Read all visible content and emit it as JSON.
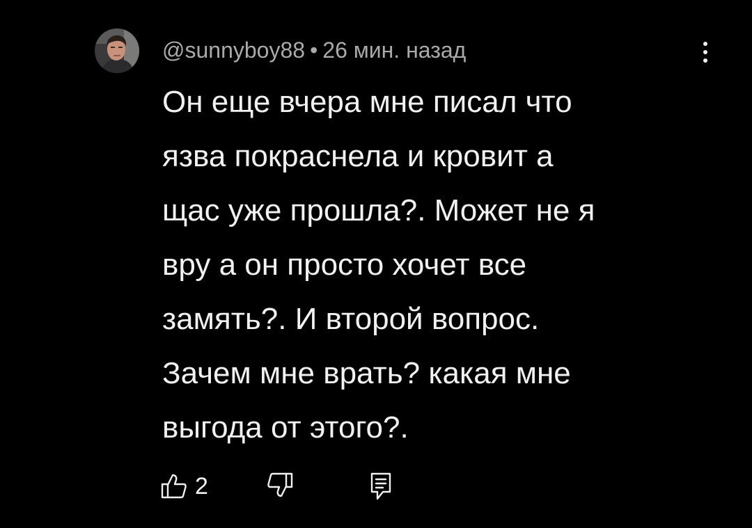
{
  "comment": {
    "author": "@sunnyboy88",
    "separator": "•",
    "time": "26 мин. назад",
    "text": "Он еще вчера мне писал что\nязва покраснела и кровит а\nщас уже прошла?. Может не я\nвру а он просто хочет все\nзамять?. И второй вопрос.\nЗачем мне врать? какая мне\nвыгода от этого?.",
    "likes": "2"
  },
  "icons": {
    "avatar": "user-avatar-photo",
    "menu": "more-vertical-icon",
    "like": "thumbs-up-icon",
    "dislike": "thumbs-down-icon",
    "reply": "reply-comment-icon"
  },
  "colors": {
    "background": "#000000",
    "text": "#f1f1f1",
    "meta": "#aaaaaa"
  }
}
